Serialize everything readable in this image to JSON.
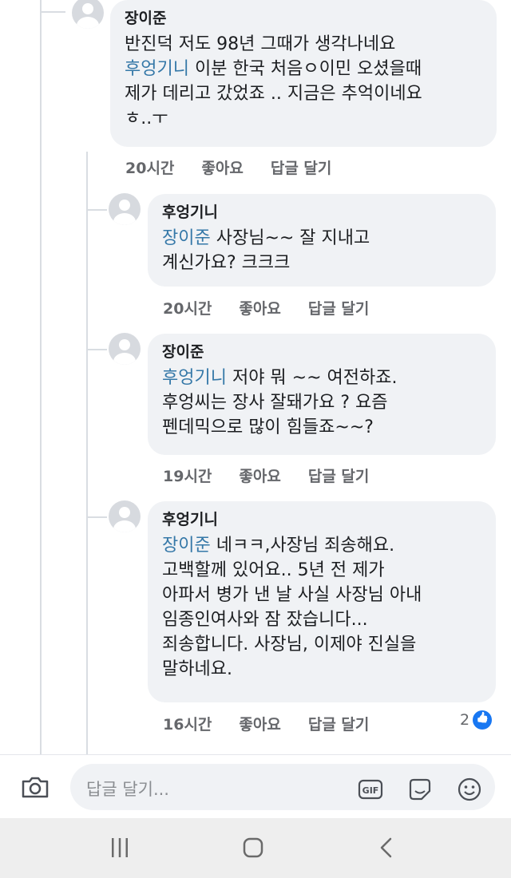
{
  "comments": [
    {
      "author": "장이준",
      "mention": "",
      "text": "반진덕 저도 98년 그때가  생각나네요",
      "mention2": "후엉기니",
      "text2": " 이분 한국 처음ㅇ이민 오셨을때\n제가 데리고 갔었죠 .. 지금은 추억이네요\nㅎ..ㅜ",
      "time": "20시간",
      "like": "좋아요",
      "reply": "답글 달기"
    },
    {
      "author": "후엉기니",
      "mention": "장이준",
      "text": " 사장님~~  잘 지내고\n계신가요? 크크크",
      "time": "20시간",
      "like": "좋아요",
      "reply": "답글 달기"
    },
    {
      "author": "장이준",
      "mention": "후엉기니",
      "text": " 저야 뭐 ~~ 여전하죠.\n후엉씨는 장사 잘돼가요 ? 요즘\n펜데믹으로 많이 힘들죠~~?",
      "time": "19시간",
      "like": "좋아요",
      "reply": "답글 달기"
    },
    {
      "author": "후엉기니",
      "mention": "장이준",
      "text": " 네ㅋㅋ,사장님 죄송해요.\n고백할께 있어요.. 5년 전 제가\n아파서 병가 낸 날 사실 사장님 아내\n임종인여사와 잠 잤습니다...\n죄송합니다. 사장님, 이제야 진실을\n말하네요.",
      "time": "16시간",
      "like": "좋아요",
      "reply": "답글 달기",
      "reaction_count": "2"
    }
  ],
  "composer": {
    "placeholder": "답글 달기..."
  },
  "icons": {
    "camera": "camera-icon",
    "gif": "gif-icon",
    "sticker": "sticker-icon",
    "emoji": "emoji-icon",
    "recent": "recent-apps-icon",
    "home": "home-icon",
    "back": "back-icon"
  },
  "colors": {
    "mention": "#3578a8",
    "bubble": "#f0f2f5",
    "like": "#1877f2"
  }
}
